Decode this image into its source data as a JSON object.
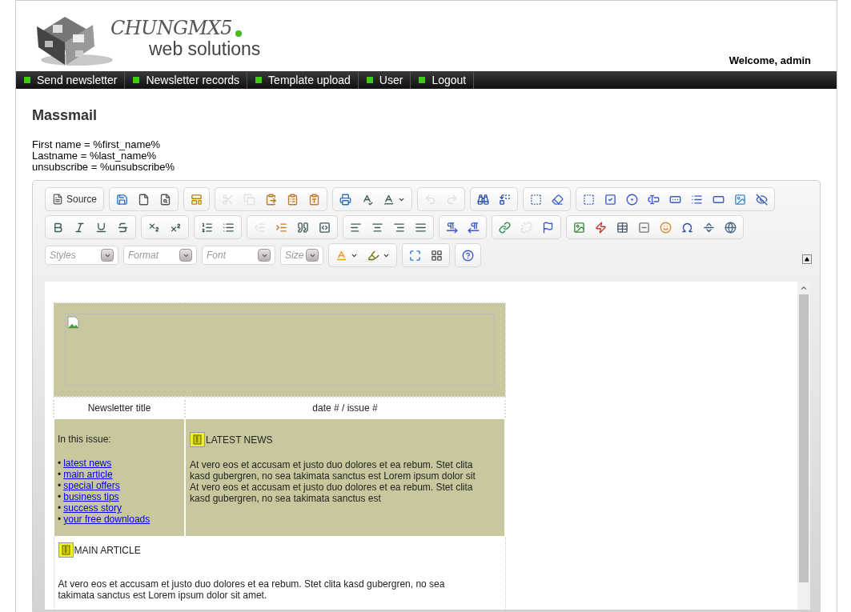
{
  "header": {
    "logo": {
      "name": "CHUNGMX5",
      "tagline": "web solutions"
    },
    "welcome": "Welcome, admin"
  },
  "nav": [
    {
      "label": "Send newsletter"
    },
    {
      "label": "Newsletter records"
    },
    {
      "label": "Template upload"
    },
    {
      "label": "User"
    },
    {
      "label": "Logout"
    }
  ],
  "page": {
    "title": "Massmail",
    "variables": [
      "First name = %first_name%",
      "Lastname = %last_name%",
      "unsubscribe = %unsubscribe%"
    ]
  },
  "toolbar": {
    "row_1": [
      [
        {
          "kind": "text",
          "label": "Source",
          "disabled": false
        }
      ],
      [
        {
          "kind": "icon",
          "disabled": false
        },
        {
          "kind": "icon",
          "disabled": false
        },
        {
          "kind": "icon",
          "disabled": false
        }
      ],
      [
        {
          "kind": "icon",
          "disabled": false
        }
      ],
      [
        {
          "kind": "icon",
          "disabled": true
        },
        {
          "kind": "icon",
          "disabled": true
        },
        {
          "kind": "icon",
          "disabled": false
        },
        {
          "kind": "icon",
          "disabled": false
        },
        {
          "kind": "icon",
          "disabled": false
        }
      ],
      [
        {
          "kind": "icon",
          "disabled": false
        },
        {
          "kind": "icon",
          "disabled": false
        },
        {
          "kind": "menu",
          "disabled": false
        }
      ],
      [
        {
          "kind": "icon",
          "disabled": true
        },
        {
          "kind": "icon",
          "disabled": true
        }
      ],
      [
        {
          "kind": "icon",
          "disabled": false
        },
        {
          "kind": "icon",
          "disabled": false
        }
      ],
      [
        {
          "kind": "icon",
          "disabled": false
        },
        {
          "kind": "icon",
          "disabled": false
        }
      ],
      [
        {
          "kind": "icon",
          "disabled": false
        },
        {
          "kind": "icon",
          "disabled": false
        },
        {
          "kind": "icon",
          "disabled": false
        },
        {
          "kind": "icon",
          "disabled": false
        },
        {
          "kind": "icon",
          "disabled": false
        },
        {
          "kind": "icon",
          "disabled": false
        },
        {
          "kind": "icon",
          "disabled": false
        },
        {
          "kind": "icon",
          "disabled": false
        },
        {
          "kind": "icon",
          "disabled": false
        }
      ]
    ],
    "row_2": [
      [
        {
          "kind": "icon",
          "disabled": false
        },
        {
          "kind": "icon",
          "disabled": false
        },
        {
          "kind": "icon",
          "disabled": false
        },
        {
          "kind": "icon",
          "disabled": false
        }
      ],
      [
        {
          "kind": "icon",
          "disabled": false
        },
        {
          "kind": "icon",
          "disabled": false
        }
      ],
      [
        {
          "kind": "icon",
          "disabled": false
        },
        {
          "kind": "icon",
          "disabled": false
        }
      ],
      [
        {
          "kind": "icon",
          "disabled": true
        },
        {
          "kind": "icon",
          "disabled": false
        },
        {
          "kind": "icon",
          "disabled": false
        },
        {
          "kind": "icon",
          "disabled": false
        }
      ],
      [
        {
          "kind": "icon",
          "disabled": false
        },
        {
          "kind": "icon",
          "disabled": false
        },
        {
          "kind": "icon",
          "disabled": false
        },
        {
          "kind": "icon",
          "disabled": false
        }
      ],
      [
        {
          "kind": "icon",
          "disabled": false
        },
        {
          "kind": "icon",
          "disabled": false
        }
      ],
      [
        {
          "kind": "icon",
          "disabled": false
        },
        {
          "kind": "icon",
          "disabled": true
        },
        {
          "kind": "icon",
          "disabled": false
        }
      ],
      [
        {
          "kind": "icon",
          "disabled": false
        },
        {
          "kind": "icon",
          "disabled": false
        },
        {
          "kind": "icon",
          "disabled": false
        },
        {
          "kind": "icon",
          "disabled": false
        },
        {
          "kind": "icon",
          "disabled": false
        },
        {
          "kind": "icon",
          "disabled": false
        },
        {
          "kind": "icon",
          "disabled": false
        },
        {
          "kind": "icon",
          "disabled": false
        }
      ]
    ],
    "combos": [
      {
        "placeholder": "Styles"
      },
      {
        "placeholder": "Format"
      },
      {
        "placeholder": "Font"
      },
      {
        "placeholder": "Size"
      }
    ],
    "row_3": [
      [
        {
          "kind": "menu",
          "disabled": false
        },
        {
          "kind": "menu",
          "disabled": false
        }
      ],
      [
        {
          "kind": "icon",
          "disabled": false
        },
        {
          "kind": "icon",
          "disabled": false
        }
      ],
      [
        {
          "kind": "icon",
          "disabled": false
        }
      ]
    ]
  },
  "document": {
    "title_cell": "Newsletter title",
    "issue_cell": "date # / issue #",
    "contents_heading": "In this issue:",
    "contents": [
      {
        "bullet": "•",
        "link": "latest news"
      },
      {
        "bullet": "•",
        "link": "main article"
      },
      {
        "bullet": "•",
        "link": "special offers"
      },
      {
        "bullet": "•",
        "link": "business tips"
      },
      {
        "bullet": "•",
        "link": "success story"
      },
      {
        "bullet": "•",
        "link": "your free downloads"
      }
    ],
    "news_heading": "LATEST NEWS",
    "news_text": "At vero eos et accusam et justo duo dolores et ea rebum. Stet clita kasd gubergren, no sea takimata sanctus est Lorem ipsum dolor sit At vero eos et accusam et justo duo dolores et ea rebum. Stet clita kasd gubergren, no sea takimata sanctus est",
    "article_heading": "MAIN ARTICLE",
    "article_text": "At vero eos et accusam et justo duo dolores et ea rebum. Stet clita kasd gubergren, no sea takimata sanctus est Lorem ipsum dolor sit amet."
  }
}
